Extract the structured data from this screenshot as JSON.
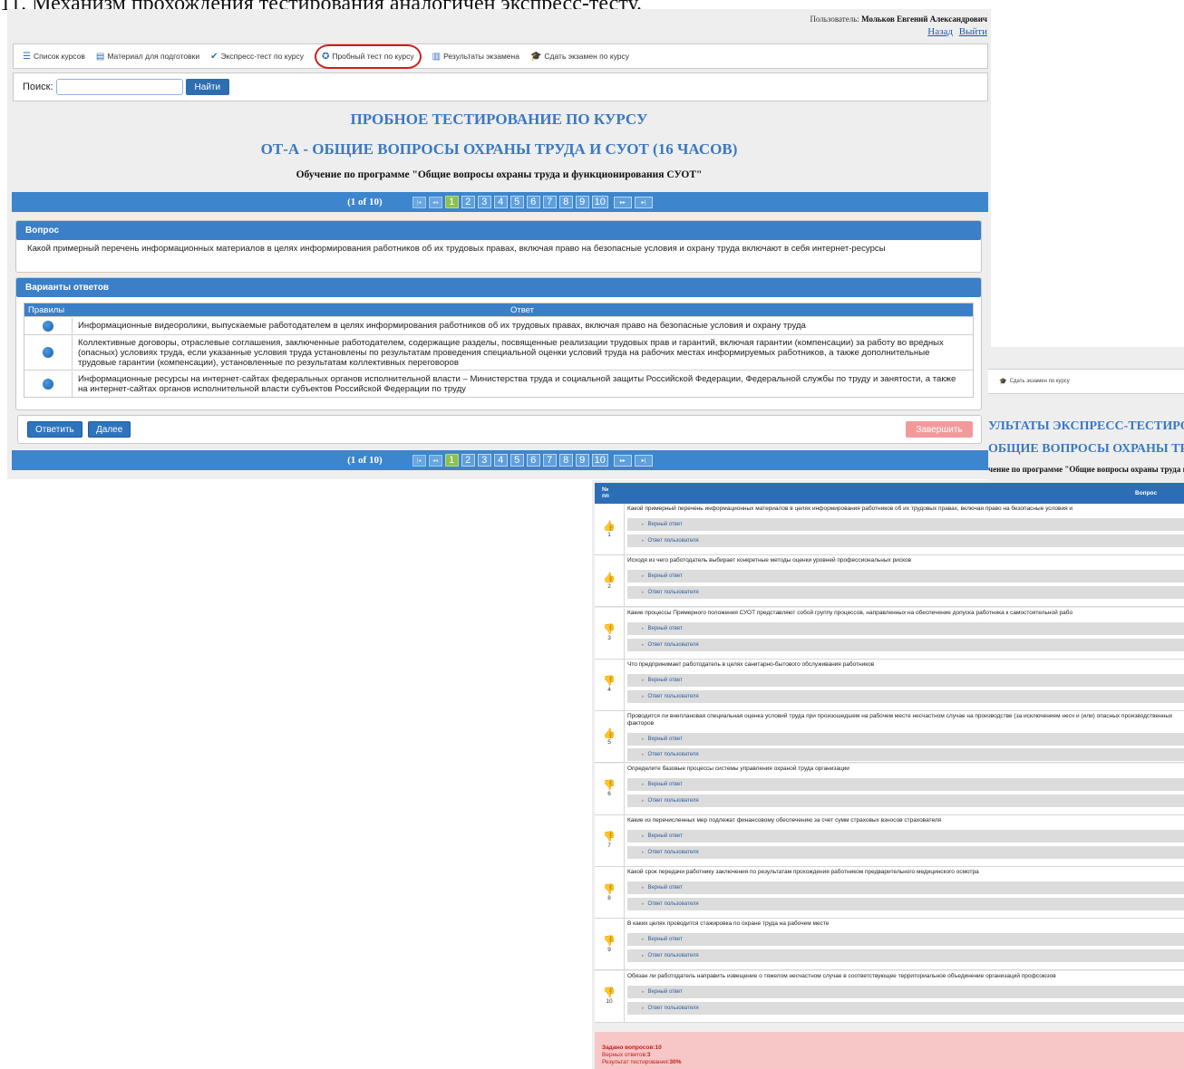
{
  "caption_fragment": "11. Механизм прохождения тестирования аналогичен экспресс-тесту.",
  "user": {
    "label": "Пользователь:",
    "name": "Мольков Евгений Александрович",
    "back_link": "Назад",
    "logout_link": "Выйти"
  },
  "nav": [
    {
      "icon": "list-icon",
      "glyph": "☰",
      "label": "Список курсов"
    },
    {
      "icon": "document-icon",
      "glyph": "▤",
      "label": "Материал для подготовки"
    },
    {
      "icon": "checkmark-icon",
      "glyph": "✔",
      "label": "Экспресс-тест по курсу"
    },
    {
      "icon": "check-circle-icon",
      "glyph": "✪",
      "label": "Пробный тест по курсу",
      "active": true
    },
    {
      "icon": "chart-icon",
      "glyph": "▥",
      "label": "Результаты экзамена"
    },
    {
      "icon": "graduation-cap-icon",
      "glyph": "🎓",
      "label": "Сдать экзамен по курсу"
    }
  ],
  "search": {
    "label": "Поиск:",
    "value": "",
    "button": "Найти"
  },
  "page1": {
    "heading": "ПРОБНОЕ ТЕСТИРОВАНИЕ ПО КУРСУ",
    "course": "ОТ-А - ОБЩИЕ ВОПРОСЫ ОХРАНЫ ТРУДА И СУОТ (16 ЧАСОВ)",
    "program": "Обучение по программе \"Общие вопросы охраны труда и функционирования СУОТ\"",
    "pager": {
      "count": "(1 of 10)",
      "pages": [
        "1",
        "2",
        "3",
        "4",
        "5",
        "6",
        "7",
        "8",
        "9",
        "10"
      ],
      "current": "1"
    },
    "question_header": "Вопрос",
    "question_text": "Какой примерный перечень информационных материалов в целях информирования работников об их трудовых правах, включая право на безопасные условия и охрану труда включают в себя интернет-ресурсы",
    "answers_header": "Варианты ответов",
    "col_right": "Правилы",
    "col_answer": "Ответ",
    "answers": [
      "Информационные видеоролики, выпускаемые работодателем в целях информирования работников об их трудовых правах, включая право на безопасные условия и охрану труда",
      "Коллективные договоры, отраслевые соглашения, заключенные работодателем, содержащие разделы, посвященные реализации трудовых прав и гарантий, включая гарантии (компенсации) за работу во вредных (опасных) условиях труда, если указанные условия труда установлены по результатам проведения специальной оценки условий труда на рабочих местах информируемых работников, а также дополнительные трудовые гарантии (компенсации), установленные по результатам коллективных переговоров",
      "Информационные ресурсы на интернет-сайтах федеральных органов исполнительной власти – Министерства труда и социальной защиты Российской Федерации, Федеральной службы по труду и занятости, а также на интернет-сайтах органов исполнительной власти субъектов Российской Федерации по труду"
    ],
    "btn_answer": "Ответить",
    "btn_next": "Далее",
    "btn_finish": "Завершить"
  },
  "page2": {
    "nav_label": "Сдать экзамен по курсу",
    "heading_fragment": "УЛЬТАТЫ ЭКСПРЕСС-ТЕСТИРО",
    "course_fragment": "ОБЩИЕ ВОПРОСЫ ОХРАНЫ ТРУ",
    "program_fragment": "чение по программе \"Общие вопросы охраны труда и",
    "col_no": "№\nпп",
    "col_question": "Вопрос",
    "correct_label": "Верный ответ",
    "user_label": "Ответ пользователя",
    "questions": [
      {
        "n": "1",
        "ok": true,
        "text": "Какой примерный перечень информационных материалов в целях информирования работников об их трудовых правах, включая право на безопасные условия и"
      },
      {
        "n": "2",
        "ok": true,
        "text": "Исходя из чего работодатель выбирает конкретные методы оценки уровней профессиональных рисков"
      },
      {
        "n": "3",
        "ok": false,
        "text": "Какие процессы Примерного положения СУОТ представляют собой группу процессов, направленных на обеспечение допуска работника к самостоятельной рабо"
      },
      {
        "n": "4",
        "ok": false,
        "text": "Что предпринимает работодатель в целях санитарно-бытового обслуживания работников"
      },
      {
        "n": "5",
        "ok": true,
        "text": "Проводится ли внеплановая специальная оценка условий труда при произошедшем на рабочем месте несчастном случае на производстве (за исключением несч и (или) опасных производственных факторов",
        "two": true
      },
      {
        "n": "6",
        "ok": false,
        "text": "Определите базовые процессы системы управления охраной труда организации"
      },
      {
        "n": "7",
        "ok": false,
        "text": "Какие из перечисленных мер подлежат финансовому обеспечению за счет сумм страховых взносов страхователя"
      },
      {
        "n": "8",
        "ok": false,
        "text": "Какой срок передачи работнику заключения по результатам прохождения работником предварительного медицинского осмотра"
      },
      {
        "n": "9",
        "ok": false,
        "text": "В каких целях проводится стажировка по охране труда на рабочем месте"
      },
      {
        "n": "10",
        "ok": false,
        "text": "Обязан ли работодатель направить извещение о тяжелом несчастном случае в соответствующее территориальное объединение организаций профсоюзов"
      }
    ],
    "summary": {
      "asked_label": "Задано вопросов:",
      "asked": "10",
      "correct_label": "Верных ответов:",
      "correct": "3",
      "result_label": "Результат тестирования:",
      "result": "30%"
    }
  }
}
